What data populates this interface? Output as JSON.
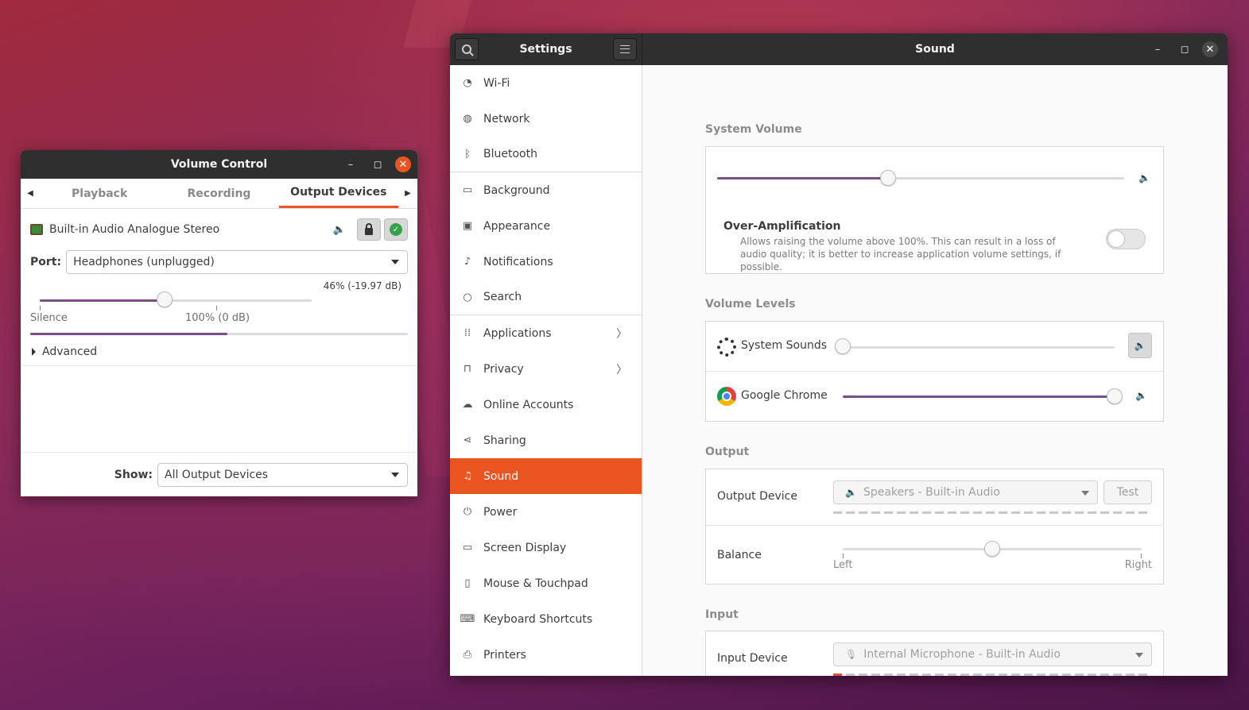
{
  "volume_control": {
    "title": "Volume Control",
    "tabs": [
      "Playback",
      "Recording",
      "Output Devices"
    ],
    "active_tab": "Output Devices",
    "device_name": "Built-in Audio Analogue Stereo",
    "port_label": "Port:",
    "port_value": "Headphones (unplugged)",
    "volume_percent_text": "46% (-19.97 dB)",
    "volume_level": 0.46,
    "mark_silence": "Silence",
    "mark_100": "100% (0 dB)",
    "advanced_label": "Advanced",
    "show_label": "Show:",
    "show_value": "All Output Devices"
  },
  "settings": {
    "app_title": "Settings",
    "page_title": "Sound",
    "sidebar": [
      {
        "label": "Wi-Fi",
        "icon": "wifi-icon",
        "glyph": "◔"
      },
      {
        "label": "Network",
        "icon": "network-icon",
        "glyph": "◍"
      },
      {
        "label": "Bluetooth",
        "icon": "bluetooth-icon",
        "glyph": "ᛒ"
      },
      {
        "label": "Background",
        "icon": "background-icon",
        "glyph": "▭"
      },
      {
        "label": "Appearance",
        "icon": "appearance-icon",
        "glyph": "▣"
      },
      {
        "label": "Notifications",
        "icon": "bell-icon",
        "glyph": "♪"
      },
      {
        "label": "Search",
        "icon": "search-icon",
        "glyph": "○"
      },
      {
        "label": "Applications",
        "icon": "grid-icon",
        "glyph": "⁞⁞"
      },
      {
        "label": "Privacy",
        "icon": "lock-icon",
        "glyph": "⊓"
      },
      {
        "label": "Online Accounts",
        "icon": "cloud-icon",
        "glyph": "☁"
      },
      {
        "label": "Sharing",
        "icon": "share-icon",
        "glyph": "⋖"
      },
      {
        "label": "Sound",
        "icon": "music-note-icon",
        "glyph": "♫"
      },
      {
        "label": "Power",
        "icon": "power-icon",
        "glyph": "⏻"
      },
      {
        "label": "Screen Display",
        "icon": "display-icon",
        "glyph": "▭"
      },
      {
        "label": "Mouse & Touchpad",
        "icon": "mouse-icon",
        "glyph": "▯"
      },
      {
        "label": "Keyboard Shortcuts",
        "icon": "keyboard-icon",
        "glyph": "⌨"
      },
      {
        "label": "Printers",
        "icon": "printer-icon",
        "glyph": "⎙"
      }
    ],
    "active_item": "Sound",
    "system_volume": {
      "title": "System Volume",
      "level": 0.42,
      "over_amp_title": "Over-Amplification",
      "over_amp_desc": "Allows raising the volume above 100%. This can result in a loss of audio quality; it is better to increase application volume settings, if possible.",
      "over_amp_enabled": false
    },
    "volume_levels": {
      "title": "Volume Levels",
      "apps": [
        {
          "name": "System Sounds",
          "level": 0.0
        },
        {
          "name": "Google Chrome",
          "level": 1.0
        }
      ]
    },
    "output": {
      "title": "Output",
      "device_label": "Output Device",
      "device_value": "Speakers - Built-in Audio",
      "test_label": "Test",
      "balance_label": "Balance",
      "balance_level": 0.5,
      "left_label": "Left",
      "right_label": "Right"
    },
    "input": {
      "title": "Input",
      "device_label": "Input Device",
      "device_value": "Internal Microphone - Built-in Audio"
    }
  },
  "colors": {
    "accent": "#e95420",
    "slider_fill": "#7d4e85",
    "titlebar": "#2f2f2f"
  }
}
